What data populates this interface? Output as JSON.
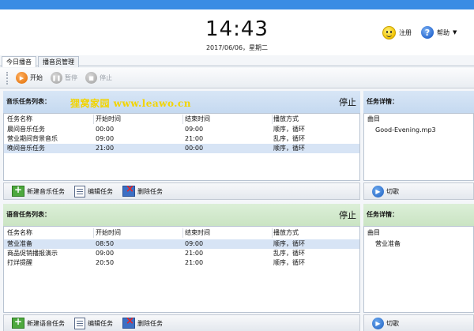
{
  "header": {
    "time": "14:43",
    "date": "2017/06/06，星期二",
    "register_label": "注册",
    "help_label": "帮助"
  },
  "tabs": [
    {
      "label": "今日播音"
    },
    {
      "label": "播音员管理"
    }
  ],
  "toolbar": {
    "start_label": "开始",
    "pause_label": "暂停",
    "stop_label": "停止"
  },
  "watermark": "狸窝家园 www.leawo.cn",
  "music": {
    "title": "音乐任务列表：",
    "status": "停止",
    "columns": [
      "任务名称",
      "开始时间",
      "结束时间",
      "播放方式"
    ],
    "rows": [
      [
        "晨间音乐任务",
        "00:00",
        "09:00",
        "顺序，循环"
      ],
      [
        "营业期间背景音乐",
        "09:00",
        "21:00",
        "乱序，循环"
      ],
      [
        "晚间音乐任务",
        "21:00",
        "00:00",
        "顺序，循环"
      ]
    ],
    "detail_title": "任务详情：",
    "detail_column": "曲目",
    "detail_items": [
      "Good-Evening.mp3"
    ],
    "buttons": {
      "new": "新建音乐任务",
      "edit": "编辑任务",
      "delete": "删除任务",
      "switch": "切歌"
    }
  },
  "voice": {
    "title": "语音任务列表：",
    "status": "停止",
    "columns": [
      "任务名称",
      "开始时间",
      "结束时间",
      "播放方式"
    ],
    "rows": [
      [
        "营业准备",
        "08:50",
        "09:00",
        "顺序，循环"
      ],
      [
        "商品促销播报演示",
        "09:00",
        "21:00",
        "乱序，循环"
      ],
      [
        "打烊提醒",
        "20:50",
        "21:00",
        "顺序，循环"
      ]
    ],
    "detail_title": "任务详情：",
    "detail_column": "曲目",
    "detail_items": [
      "营业准备"
    ],
    "buttons": {
      "new": "新建语音任务",
      "edit": "编辑任务",
      "delete": "删除任务",
      "switch": "切歌"
    }
  },
  "colors": {
    "title_bar": "#3a8ce4",
    "music_header": "#c5d9f0",
    "voice_header": "#cae4c3",
    "selected_row": "#d7e4f5",
    "watermark": "#f2d400"
  }
}
